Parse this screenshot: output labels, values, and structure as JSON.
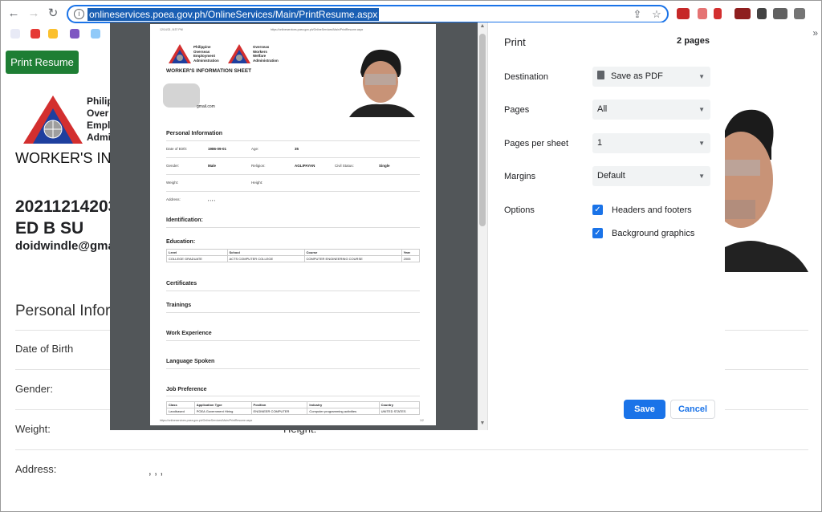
{
  "browser": {
    "url": "onlineservices.poea.gov.ph/OnlineServices/Main/PrintResume.aspx",
    "back_icon": "←",
    "forward_icon": "→",
    "reload_icon": "↻",
    "lock_icon": "i",
    "share_icon": "⇪",
    "star_icon": "☆",
    "bookmarks_more": "»"
  },
  "page": {
    "print_button": "Print Resume",
    "agency_lines": [
      "Philip",
      "Over",
      "Empl",
      "Admi"
    ],
    "sheet_title": "WORKER'S INI",
    "reference_no": "20211214203",
    "name": "ED B SU",
    "email": "doidwindle@gma",
    "section_title": "Personal Infor",
    "rows": [
      {
        "label": "Date of Birth",
        "value": ""
      },
      {
        "label": "Gender:",
        "value": ""
      },
      {
        "label": "Weight:",
        "value": "Height:"
      },
      {
        "label": "Address:",
        "value": ", , ,"
      }
    ]
  },
  "preview": {
    "header_left": "12/14/21, 8:37 PM",
    "header_mid": "https://onlineservices.poea.gov.ph/OnlineServices/Main/PrintResume.aspx",
    "logo1_text": [
      "Philippine",
      "Overseas",
      "Employment",
      "Administration"
    ],
    "logo2_text": [
      "Overseas",
      "Workers",
      "Welfare",
      "Administration"
    ],
    "sheet_title": "WORKER'S INFORMATION SHEET",
    "email_suffix": "gmail.com",
    "personal_info": "Personal Information",
    "dob_label": "Date of Birth:",
    "dob_value": "1986-09-01",
    "age_label": "Age:",
    "age_value": "35",
    "gender_label": "Gender:",
    "gender_value": "Male",
    "religion_label": "Religion:",
    "religion_value": "AGLIPAYAN",
    "civil_label": "Civil Status:",
    "civil_value": "Single",
    "weight_label": "Weight:",
    "height_label": "Height:",
    "address_label": "Address:",
    "address_value": ", , , ,",
    "identification": "Identification:",
    "education": "Education:",
    "edu_headers": [
      "Level",
      "School",
      "Course",
      "Year"
    ],
    "edu_row": [
      "COLLEGE GRADUATE",
      "ACTS COMPUTER COLLEGE",
      "COMPUTER ENGINEERING COURSE",
      "2005"
    ],
    "certificates": "Certificates",
    "trainings": "Trainings",
    "work_experience": "Work Experience",
    "language_spoken": "Language Spoken",
    "job_preference": "Job Preference",
    "job_headers": [
      "Class",
      "Application Type",
      "Position",
      "Industry",
      "Country"
    ],
    "job_row": [
      "Landbased",
      "POEA Government Hiring",
      "ENGINEER COMPUTER",
      "Computer programming activities",
      "UNITED STATES"
    ],
    "footer_url": "https://onlineservices.poea.gov.ph/OnlineServices/Main/PrintResume.aspx",
    "footer_page": "1/2"
  },
  "print_dialog": {
    "title": "Print",
    "page_count": "2 pages",
    "destination_label": "Destination",
    "destination_value": "Save as PDF",
    "pages_label": "Pages",
    "pages_value": "All",
    "pps_label": "Pages per sheet",
    "pps_value": "1",
    "margins_label": "Margins",
    "margins_value": "Default",
    "options_label": "Options",
    "headers_footers": "Headers and footers",
    "background_graphics": "Background graphics",
    "check_mark": "✓",
    "caret": "▼",
    "save": "Save",
    "cancel": "Cancel"
  }
}
